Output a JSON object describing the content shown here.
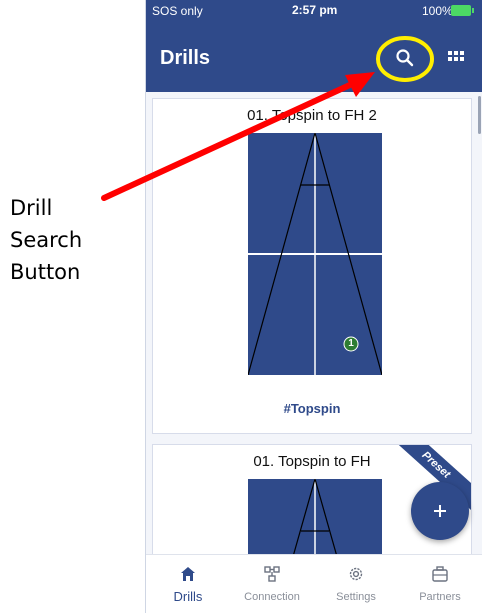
{
  "annotation": {
    "callout_lines": [
      "Drill",
      "Search",
      "Button"
    ],
    "arrow_color": "#ff0000",
    "highlight_color": "#ffee00"
  },
  "statusbar": {
    "carrier": "SOS only",
    "time": "2:57 pm",
    "battery": "100%"
  },
  "appbar": {
    "title": "Drills",
    "search_icon": "search-icon",
    "grid_icon": "grid-menu-icon"
  },
  "drills": [
    {
      "title": "01. Topspin to FH 2",
      "tag": "#Topspin",
      "ball_number": "1"
    },
    {
      "title": "01. Topspin to FH",
      "badge": "Preset"
    }
  ],
  "fab": {
    "icon": "plus-icon"
  },
  "bottom_nav": [
    {
      "label": "Drills",
      "icon": "home-icon",
      "active": true
    },
    {
      "label": "Connection",
      "icon": "connection-icon",
      "active": false
    },
    {
      "label": "Settings",
      "icon": "gear-icon",
      "active": false
    },
    {
      "label": "Partners",
      "icon": "briefcase-icon",
      "active": false
    }
  ],
  "colors": {
    "primary": "#2f4a8a",
    "ball": "#2e7d32",
    "background": "#f3f5fa"
  }
}
